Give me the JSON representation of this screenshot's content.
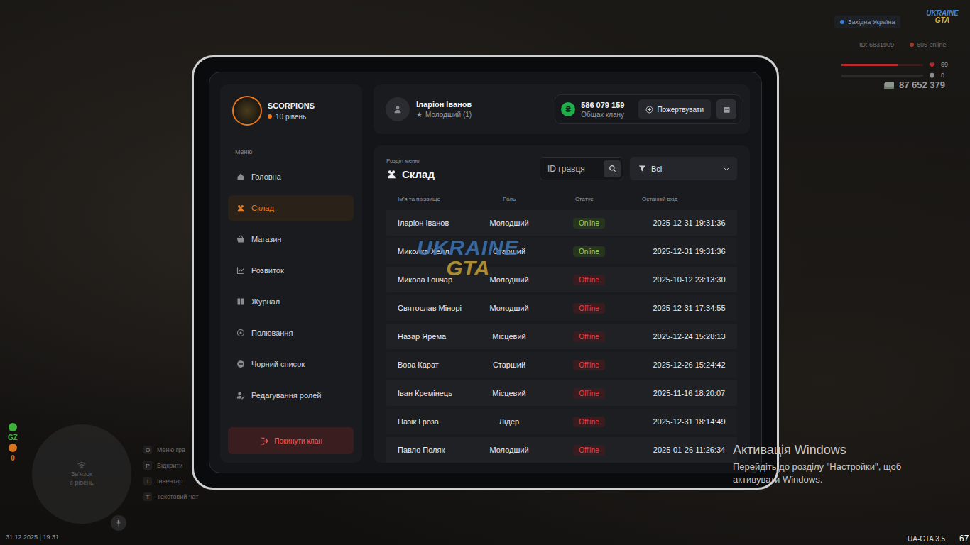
{
  "hud": {
    "region": "Західна Україна",
    "logo_top": "UKRAINE",
    "logo_bottom": "GTA",
    "player_id": "ID: 6831909",
    "online": "605 online",
    "health": "69",
    "health_level": 0.69,
    "armor": "0",
    "armor_level": 0,
    "money": "87 652 379"
  },
  "minimap": {
    "line1": "Зв'язок",
    "line2": "є рівень"
  },
  "indicators": [
    {
      "label": "GZ",
      "color": "#3fae3a"
    },
    {
      "label": "0",
      "color": "#d9741f"
    }
  ],
  "hotkeys": [
    {
      "key": "O",
      "label": "Меню гра"
    },
    {
      "key": "P",
      "label": "Відкрити"
    },
    {
      "key": "I",
      "label": "Інвентар"
    },
    {
      "key": "T",
      "label": "Текстовий чат"
    }
  ],
  "datetime": "31.12.2025 | 19:31",
  "version": "UA-GTA 3.5",
  "fps": "67",
  "windows_watermark": {
    "title": "Активація Windows",
    "text": "Перейдіть до розділу \"Настройки\", щоб активувати Windows."
  },
  "clan": {
    "name": "SCORPIONS",
    "level": "10 рівень"
  },
  "sidebar": {
    "heading": "Меню",
    "items": [
      {
        "label": "Головна",
        "selected": false
      },
      {
        "label": "Склад",
        "selected": true
      },
      {
        "label": "Магазин",
        "selected": false
      },
      {
        "label": "Розвиток",
        "selected": false
      },
      {
        "label": "Журнал",
        "selected": false
      },
      {
        "label": "Полювання",
        "selected": false
      },
      {
        "label": "Чорний список",
        "selected": false
      },
      {
        "label": "Редагування ролей",
        "selected": false
      }
    ],
    "leave_button": "Покинути клан"
  },
  "profile": {
    "name": "Іларіон Іванов",
    "rank_icon": "★",
    "rank": "Молодший (1)"
  },
  "treasury": {
    "currency_icon": "₴",
    "amount": "586 079 159",
    "label": "Общак клану",
    "donate_button": "Пожертвувати"
  },
  "section": {
    "caption": "Розділ меню",
    "title": "Склад"
  },
  "search": {
    "placeholder": "ID гравця"
  },
  "filter": {
    "value": "Всі"
  },
  "table": {
    "columns": [
      "Ім'я та прізвище",
      "Роль",
      "Статус",
      "Останній вхід"
    ],
    "rows": [
      {
        "name": "Іларіон Іванов",
        "role": "Молодший",
        "status": "Online",
        "online": true,
        "last_login": "2025-12-31 19:31:36"
      },
      {
        "name": "Миколка Хелл",
        "role": "Старший",
        "status": "Online",
        "online": true,
        "last_login": "2025-12-31 19:31:36"
      },
      {
        "name": "Микола Гончар",
        "role": "Молодший",
        "status": "Offline",
        "online": false,
        "last_login": "2025-10-12 23:13:30"
      },
      {
        "name": "Святослав Мінорі",
        "role": "Молодший",
        "status": "Offline",
        "online": false,
        "last_login": "2025-12-31 17:34:55"
      },
      {
        "name": "Назар Ярема",
        "role": "Місцевий",
        "status": "Offline",
        "online": false,
        "last_login": "2025-12-24 15:28:13"
      },
      {
        "name": "Вова Карат",
        "role": "Старший",
        "status": "Offline",
        "online": false,
        "last_login": "2025-12-26 15:24:42"
      },
      {
        "name": "Іван Кремінець",
        "role": "Місцевий",
        "status": "Offline",
        "online": false,
        "last_login": "2025-11-16 18:20:07"
      },
      {
        "name": "Назік Гроза",
        "role": "Лідер",
        "status": "Offline",
        "online": false,
        "last_login": "2025-12-31 18:14:49"
      },
      {
        "name": "Павло Поляк",
        "role": "Молодший",
        "status": "Offline",
        "online": false,
        "last_login": "2025-01-26 11:26:34"
      }
    ]
  },
  "watermark": {
    "line1": "UKRAINE",
    "line2": "GTA"
  }
}
